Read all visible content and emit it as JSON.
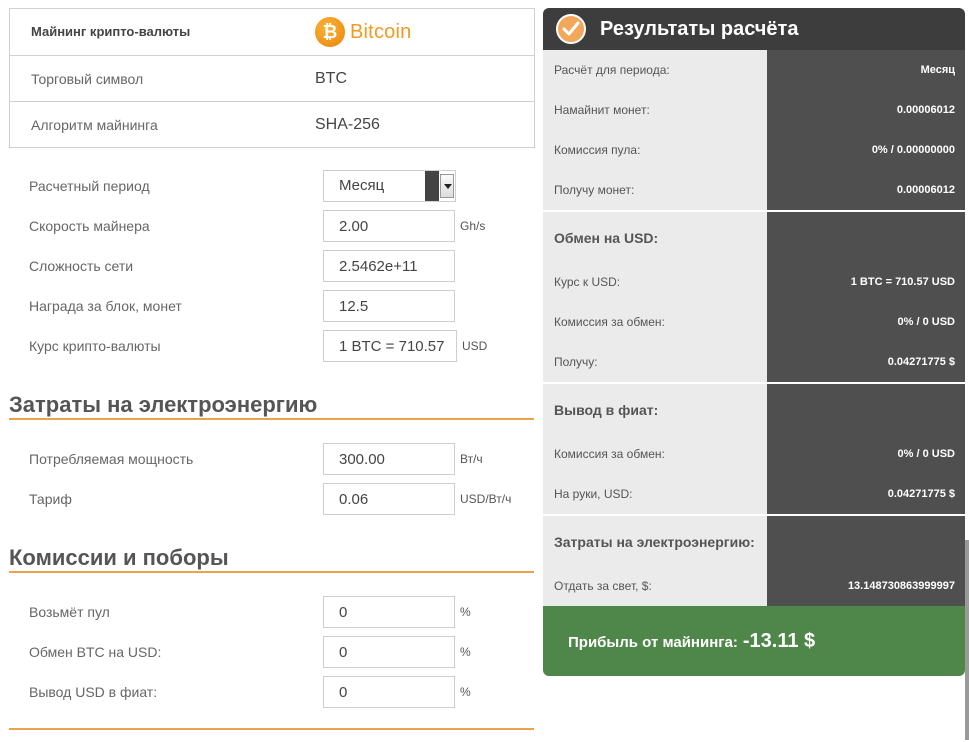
{
  "coin": {
    "header_label": "Майнинг крипто-валюты",
    "logo_symbol": "₿",
    "logo_text": "Bitcoin",
    "symbol_label": "Торговый символ",
    "symbol_value": "BTC",
    "algo_label": "Алгоритм майнинга",
    "algo_value": "SHA-256"
  },
  "form": {
    "period_label": "Расчетный период",
    "period_value": "Месяц",
    "speed_label": "Скорость майнера",
    "speed_value": "2.00",
    "speed_unit": "Gh/s",
    "difficulty_label": "Сложность сети",
    "difficulty_value": "2.5462e+11",
    "reward_label": "Награда за блок, монет",
    "reward_value": "12.5",
    "rate_label": "Курс крипто-валюты",
    "rate_value": "1 BTC = 710.57",
    "rate_unit": "USD"
  },
  "energy": {
    "title": "Затраты на электроэнергию",
    "power_label": "Потребляемая мощность",
    "power_value": "300.00",
    "power_unit": "Вт/ч",
    "tariff_label": "Тариф",
    "tariff_value": "0.06",
    "tariff_unit": "USD/Вт/ч"
  },
  "fees": {
    "title": "Комиссии и поборы",
    "pool_label": "Возьмёт пул",
    "pool_value": "0",
    "pool_unit": "%",
    "exchange_label": "Обмен BTC на USD:",
    "exchange_value": "0",
    "exchange_unit": "%",
    "withdraw_label": "Вывод USD в фиат:",
    "withdraw_value": "0",
    "withdraw_unit": "%"
  },
  "results": {
    "title": "Результаты расчёта",
    "mining": [
      {
        "label": "Расчёт для периода:",
        "value": "Месяц"
      },
      {
        "label": "Намайнит монет:",
        "value": "0.00006012"
      },
      {
        "label": "Комиссия пула:",
        "value": "0% / 0.00000000"
      },
      {
        "label": "Получу монет:",
        "value": "0.00006012"
      }
    ],
    "usd_title": "Обмен на USD:",
    "usd": [
      {
        "label": "Курс к USD:",
        "value": "1 BTC = 710.57 USD"
      },
      {
        "label": "Комиссия за обмен:",
        "value": "0% / 0 USD"
      },
      {
        "label": "Получу:",
        "value": "0.04271775 $"
      }
    ],
    "fiat_title": "Вывод в фиат:",
    "fiat": [
      {
        "label": "Комиссия за обмен:",
        "value": "0% / 0 USD"
      },
      {
        "label": "На руки, USD:",
        "value": "0.04271775 $"
      }
    ],
    "energy_title": "Затраты на электроэнергию:",
    "energy": [
      {
        "label": "Отдать за свет, $:",
        "value": "13.148730863999997"
      }
    ],
    "profit_label": "Прибыль от майнинга:",
    "profit_value": "-13.11 $"
  },
  "colors": {
    "accent_orange": "#e9a24e",
    "header_dark": "#3d3d3d",
    "value_column": "#4f4f4f",
    "profit_green": "#4f874a"
  }
}
